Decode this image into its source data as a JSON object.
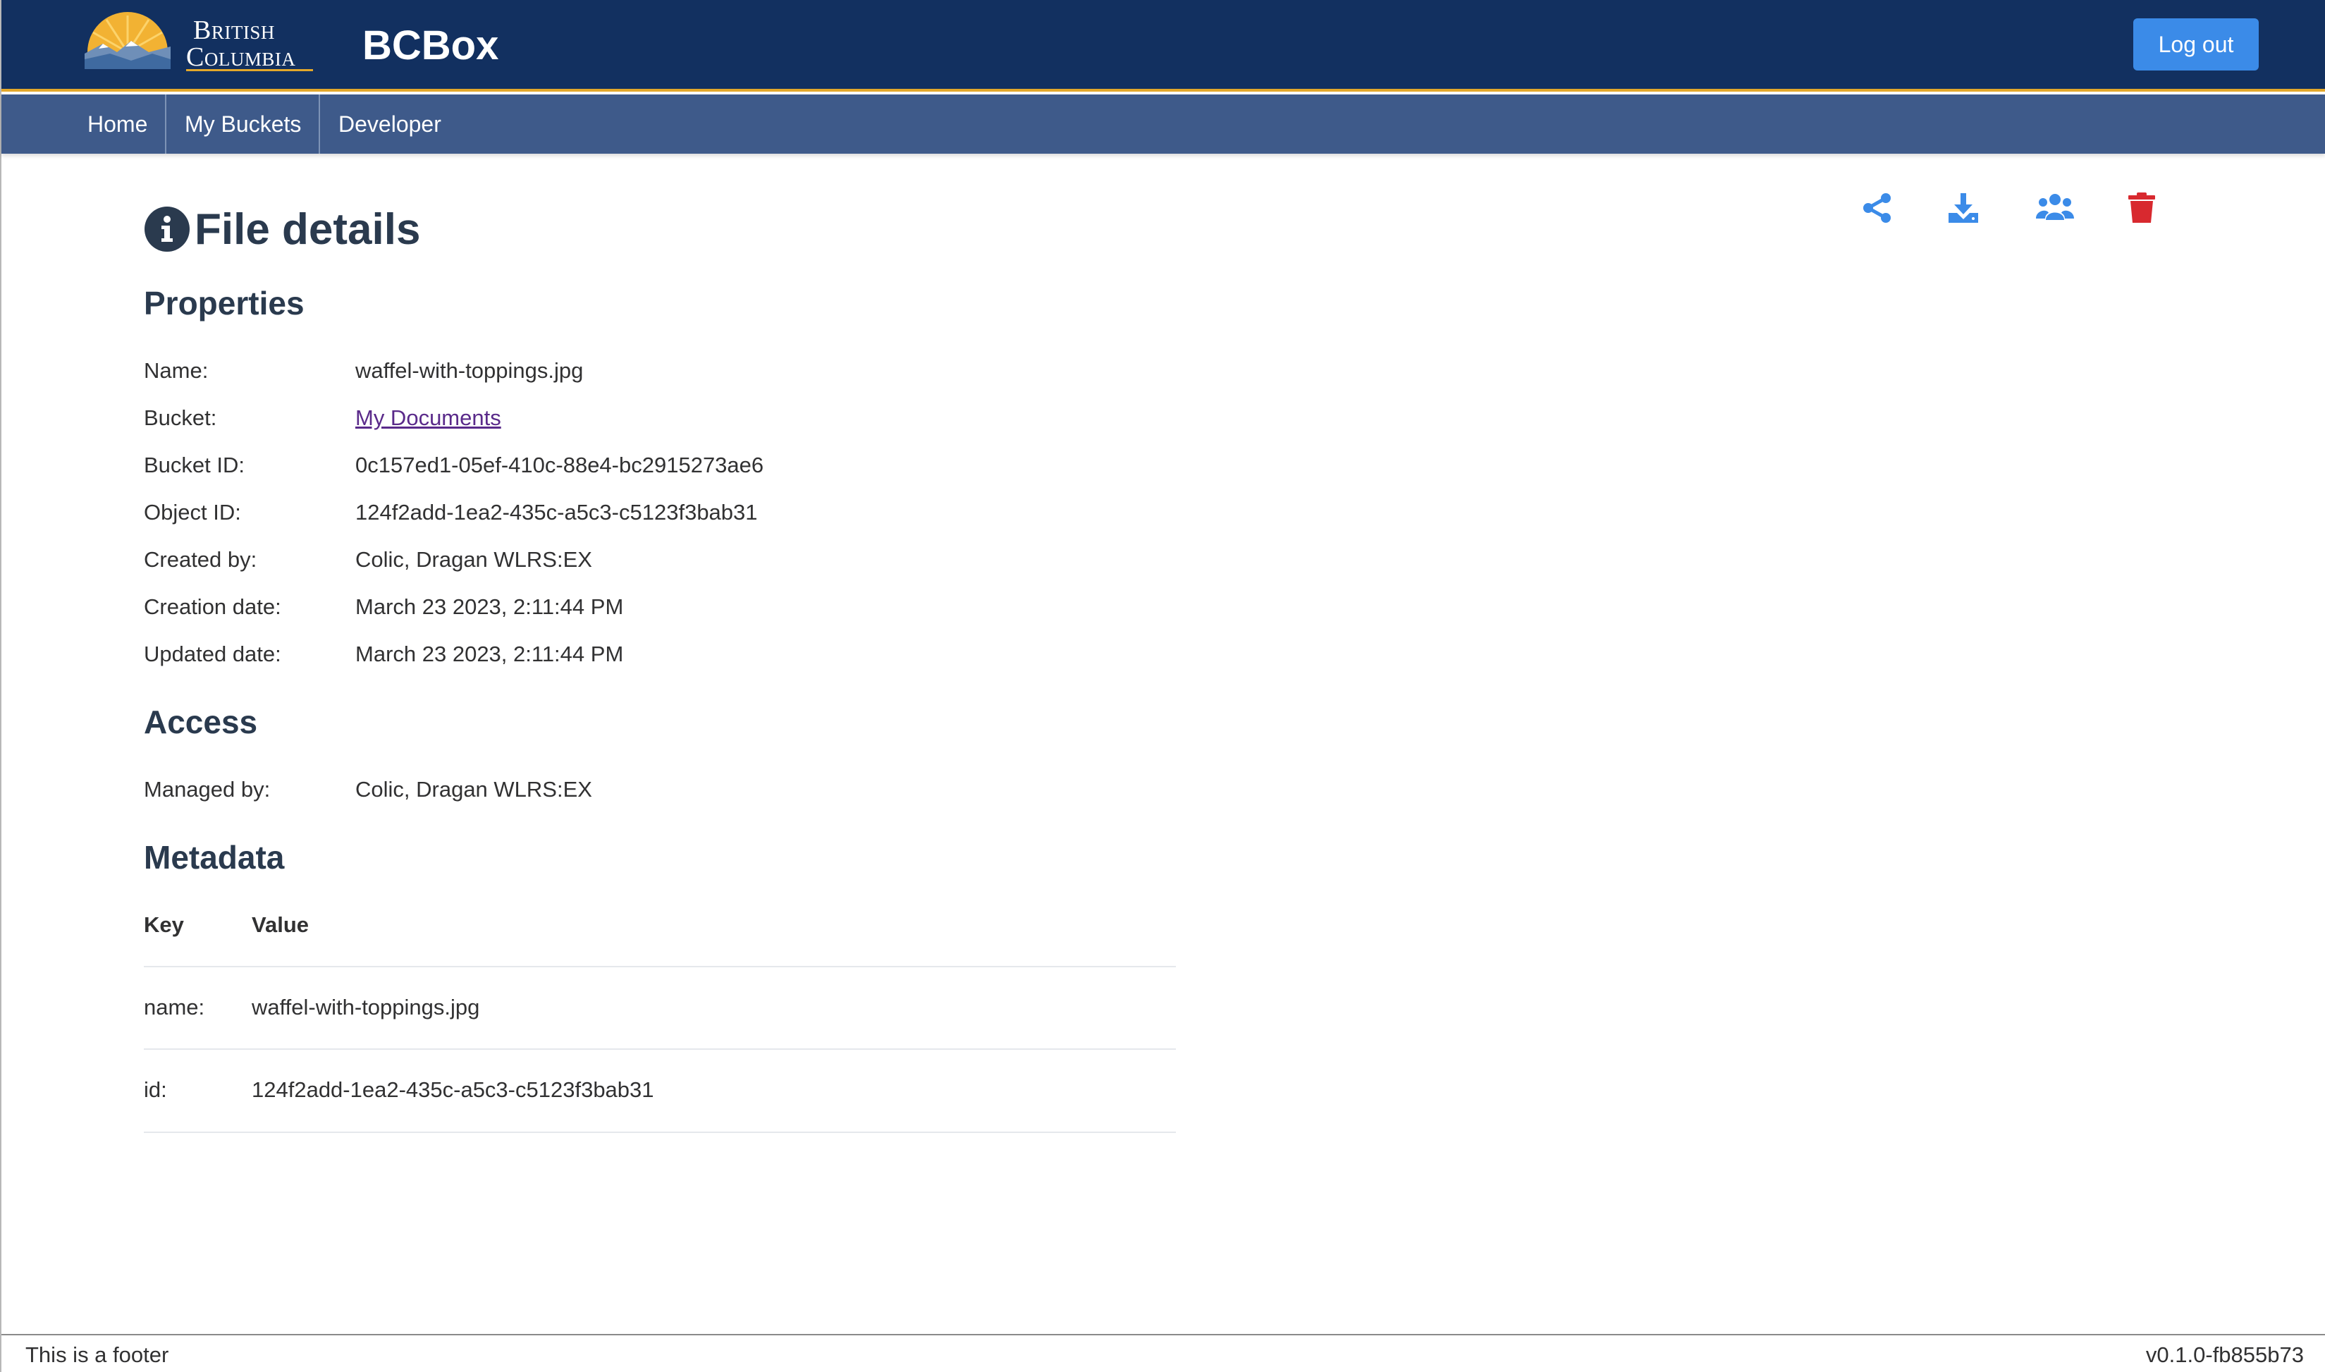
{
  "header": {
    "logo_line1": "British",
    "logo_line2": "Columbia",
    "app_title": "BCBox",
    "logout_label": "Log out",
    "brand_color": "#123060",
    "accent_color": "#e3a82b",
    "button_color": "#3b8be8"
  },
  "nav": {
    "items": [
      {
        "label": "Home"
      },
      {
        "label": "My Buckets"
      },
      {
        "label": "Developer"
      }
    ]
  },
  "page": {
    "title": "File details",
    "title_icon": "info-circle-icon",
    "actions": [
      {
        "icon": "share-icon"
      },
      {
        "icon": "download-icon"
      },
      {
        "icon": "users-permissions-icon"
      },
      {
        "icon": "trash-icon",
        "color": "#d8292f"
      }
    ]
  },
  "properties": {
    "heading": "Properties",
    "rows": [
      {
        "label": "Name:",
        "value": "waffel-with-toppings.jpg"
      },
      {
        "label": "Bucket:",
        "value": "My Documents"
      },
      {
        "label": "Bucket ID:",
        "value": "0c157ed1-05ef-410c-88e4-bc2915273ae6"
      },
      {
        "label": "Object ID:",
        "value": "124f2add-1ea2-435c-a5c3-c5123f3bab31"
      },
      {
        "label": "Created by:",
        "value": "Colic, Dragan WLRS:EX"
      },
      {
        "label": "Creation date:",
        "value": "March 23 2023, 2:11:44 PM"
      },
      {
        "label": "Updated date:",
        "value": "March 23 2023, 2:11:44 PM"
      }
    ]
  },
  "access": {
    "heading": "Access",
    "managed_label": "Managed by:",
    "managed_value": "Colic, Dragan WLRS:EX"
  },
  "metadata": {
    "heading": "Metadata",
    "col_key": "Key",
    "col_value": "Value",
    "rows": [
      {
        "key": "name:",
        "value": "waffel-with-toppings.jpg"
      },
      {
        "key": "id:",
        "value": "124f2add-1ea2-435c-a5c3-c5123f3bab31"
      }
    ]
  },
  "footer": {
    "text": "This is a footer",
    "version": "v0.1.0-fb855b73"
  }
}
